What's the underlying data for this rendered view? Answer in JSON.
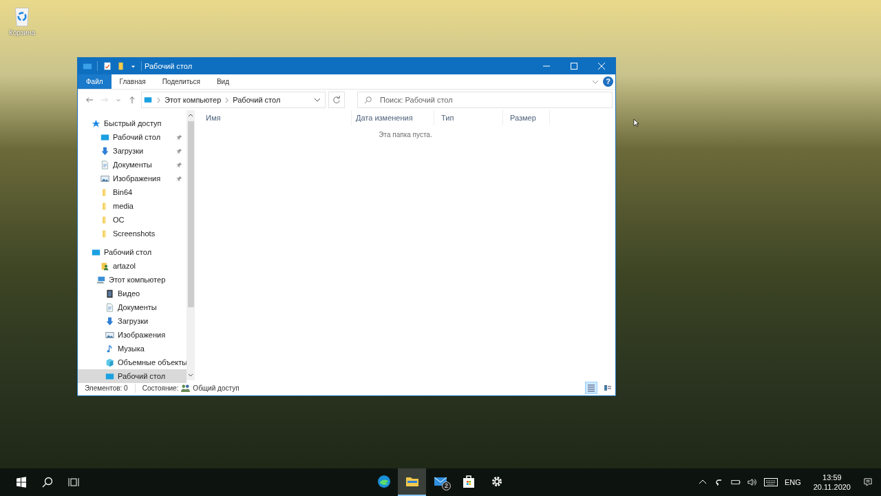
{
  "desktop": {
    "icons": [
      {
        "label": "Корзина"
      }
    ]
  },
  "window": {
    "title": "Рабочий стол",
    "tabs": [
      {
        "label": "Файл",
        "selected": true
      },
      {
        "label": "Главная",
        "selected": false
      },
      {
        "label": "Поделиться",
        "selected": false
      },
      {
        "label": "Вид",
        "selected": false
      }
    ],
    "address": [
      "Этот компьютер",
      "Рабочий стол"
    ],
    "help": "?",
    "search": {
      "placeholder": "Поиск: Рабочий стол"
    },
    "columns": [
      "Имя",
      "Дата изменения",
      "Тип",
      "Размер"
    ],
    "empty_message": "Эта папка пуста.",
    "nav": [
      {
        "label": "Быстрый доступ",
        "kind": "star",
        "selected": false,
        "children": [
          {
            "label": "Рабочий стол",
            "kind": "desktop",
            "pinned": true,
            "selected": false
          },
          {
            "label": "Загрузки",
            "kind": "download",
            "pinned": true,
            "selected": false
          },
          {
            "label": "Документы",
            "kind": "document",
            "pinned": true,
            "selected": false
          },
          {
            "label": "Изображения",
            "kind": "pictures",
            "pinned": true,
            "selected": false
          },
          {
            "label": "Bin64",
            "kind": "folder",
            "pinned": false,
            "selected": false
          },
          {
            "label": "media",
            "kind": "folder",
            "pinned": false,
            "selected": false
          },
          {
            "label": "OC",
            "kind": "folder",
            "pinned": false,
            "selected": false
          },
          {
            "label": "Screenshots",
            "kind": "folder",
            "pinned": false,
            "selected": false
          }
        ]
      },
      {
        "label": "Рабочий стол",
        "kind": "desktop",
        "selected": false,
        "children": [
          {
            "label": "artazol",
            "kind": "user",
            "selected": false
          },
          {
            "label": "Этот компьютер",
            "kind": "computer",
            "selected": false,
            "children": [
              {
                "label": "Видео",
                "kind": "video",
                "selected": false
              },
              {
                "label": "Документы",
                "kind": "document",
                "selected": false
              },
              {
                "label": "Загрузки",
                "kind": "download",
                "selected": false
              },
              {
                "label": "Изображения",
                "kind": "pictures",
                "selected": false
              },
              {
                "label": "Музыка",
                "kind": "music",
                "selected": false
              },
              {
                "label": "Объемные объекты",
                "kind": "objects3d",
                "selected": false
              },
              {
                "label": "Рабочий стол",
                "kind": "desktop",
                "selected": true
              }
            ]
          }
        ]
      }
    ],
    "status": {
      "count": "Элементов: 0",
      "state_label": "Состояние:",
      "state_value": "Общий доступ"
    },
    "views": [
      {
        "kind": "details",
        "selected": true
      },
      {
        "kind": "tiles",
        "selected": false
      }
    ]
  },
  "taskbar": {
    "apps": [
      {
        "kind": "edge",
        "selected": false
      },
      {
        "kind": "explorer",
        "selected": true
      },
      {
        "kind": "mail",
        "selected": false,
        "badge": "2"
      },
      {
        "kind": "store",
        "selected": false
      },
      {
        "kind": "settings",
        "selected": false
      }
    ],
    "language": "ENG",
    "time": "13:59",
    "date": "20.11.2020"
  }
}
